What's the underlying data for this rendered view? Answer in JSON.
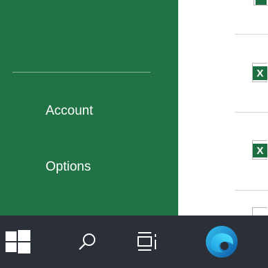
{
  "backstage": {
    "account_label": "Account",
    "options_label": "Options",
    "background_color": "#217346"
  },
  "recent_files": {
    "icon_letter": "X",
    "icon_color": "#1d6f42",
    "icon_name": "excel-file-icon"
  },
  "taskbar": {
    "background_color": "#2b2f38",
    "items": [
      "windows-start-icon",
      "search-icon",
      "task-view-icon",
      "edge-browser-icon"
    ]
  }
}
